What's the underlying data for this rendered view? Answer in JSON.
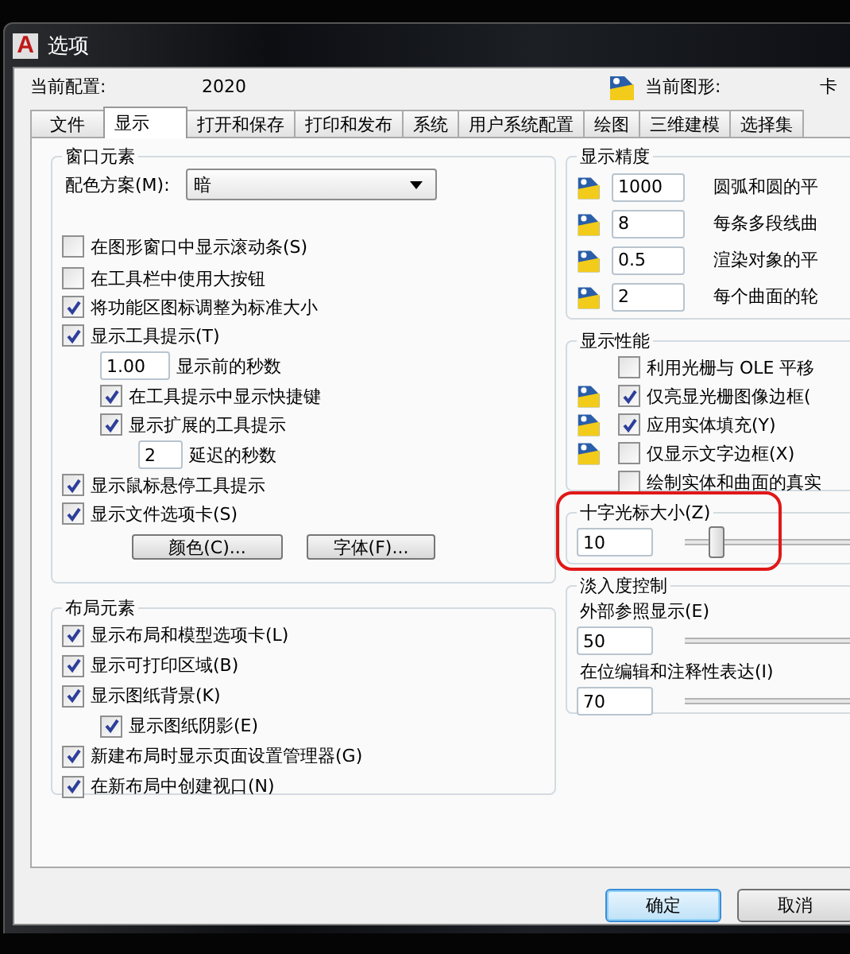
{
  "window": {
    "app_logo": "A",
    "title": "选项"
  },
  "profile": {
    "label": "当前配置:",
    "value": "2020"
  },
  "drawing": {
    "label": "当前图形:",
    "value": "卡"
  },
  "tabs": [
    {
      "label": "文件",
      "selected": false
    },
    {
      "label": "显示",
      "selected": true
    },
    {
      "label": "打开和保存",
      "selected": false
    },
    {
      "label": "打印和发布",
      "selected": false
    },
    {
      "label": "系统",
      "selected": false
    },
    {
      "label": "用户系统配置",
      "selected": false
    },
    {
      "label": "绘图",
      "selected": false
    },
    {
      "label": "三维建模",
      "selected": false
    },
    {
      "label": "选择集",
      "selected": false
    }
  ],
  "window_elements": {
    "title": "窗口元素",
    "color_scheme": {
      "label": "配色方案(M):",
      "value": "暗"
    },
    "options": [
      {
        "kind": "checkbox",
        "label": "在图形窗口中显示滚动条(S)",
        "checked": false
      },
      {
        "kind": "checkbox",
        "label": "在工具栏中使用大按钮",
        "checked": false
      },
      {
        "kind": "checkbox",
        "label": "将功能区图标调整为标准大小",
        "checked": true
      },
      {
        "kind": "checkbox",
        "label": "显示工具提示(T)",
        "checked": true,
        "children": [
          {
            "kind": "field",
            "value": "1.00",
            "label": "显示前的秒数"
          },
          {
            "kind": "checkbox",
            "label": "在工具提示中显示快捷键",
            "checked": true
          },
          {
            "kind": "checkbox",
            "label": "显示扩展的工具提示",
            "checked": true,
            "children": [
              {
                "kind": "field",
                "value": "2",
                "label": "延迟的秒数"
              }
            ]
          }
        ]
      },
      {
        "kind": "checkbox",
        "label": "显示鼠标悬停工具提示",
        "checked": true
      },
      {
        "kind": "checkbox",
        "label": "显示文件选项卡(S)",
        "checked": true
      }
    ],
    "buttons": [
      "颜色(C)...",
      "字体(F)..."
    ]
  },
  "layout_elements": {
    "title": "布局元素",
    "options": [
      {
        "kind": "checkbox",
        "label": "显示布局和模型选项卡(L)",
        "checked": true
      },
      {
        "kind": "checkbox",
        "label": "显示可打印区域(B)",
        "checked": true
      },
      {
        "kind": "checkbox",
        "label": "显示图纸背景(K)",
        "checked": true,
        "children": [
          {
            "kind": "checkbox",
            "label": "显示图纸阴影(E)",
            "checked": true
          }
        ]
      },
      {
        "kind": "checkbox",
        "label": "新建布局时显示页面设置管理器(G)",
        "checked": true
      },
      {
        "kind": "checkbox",
        "label": "在新布局中创建视口(N)",
        "checked": true
      }
    ]
  },
  "display_resolution": {
    "title": "显示精度",
    "rows": [
      {
        "value": "1000",
        "label": "圆弧和圆的平"
      },
      {
        "value": "8",
        "label": "每条多段线曲"
      },
      {
        "value": "0.5",
        "label": "渲染对象的平"
      },
      {
        "value": "2",
        "label": "每个曲面的轮"
      }
    ]
  },
  "display_performance": {
    "title": "显示性能",
    "options": [
      {
        "label": "利用光栅与 OLE 平移",
        "checked": false,
        "saved_in_drawing": false
      },
      {
        "label": "仅亮显光栅图像边框(",
        "checked": true,
        "saved_in_drawing": true
      },
      {
        "label": "应用实体填充(Y)",
        "checked": true,
        "saved_in_drawing": true
      },
      {
        "label": "仅显示文字边框(X)",
        "checked": false,
        "saved_in_drawing": true
      },
      {
        "label": "绘制实体和曲面的真实",
        "checked": false,
        "saved_in_drawing": false
      }
    ]
  },
  "crosshair_size": {
    "title": "十字光标大小(Z)",
    "value": "10",
    "level": 0.1,
    "highlighted": true
  },
  "fade_control": {
    "title": "淡入度控制",
    "items": [
      {
        "label": "外部参照显示(E)",
        "value": "50"
      },
      {
        "label": "在位编辑和注释性表达(I)",
        "value": "70"
      }
    ]
  },
  "footer_buttons": [
    {
      "label": "确定",
      "default": true
    },
    {
      "label": "取消",
      "default": false
    }
  ]
}
